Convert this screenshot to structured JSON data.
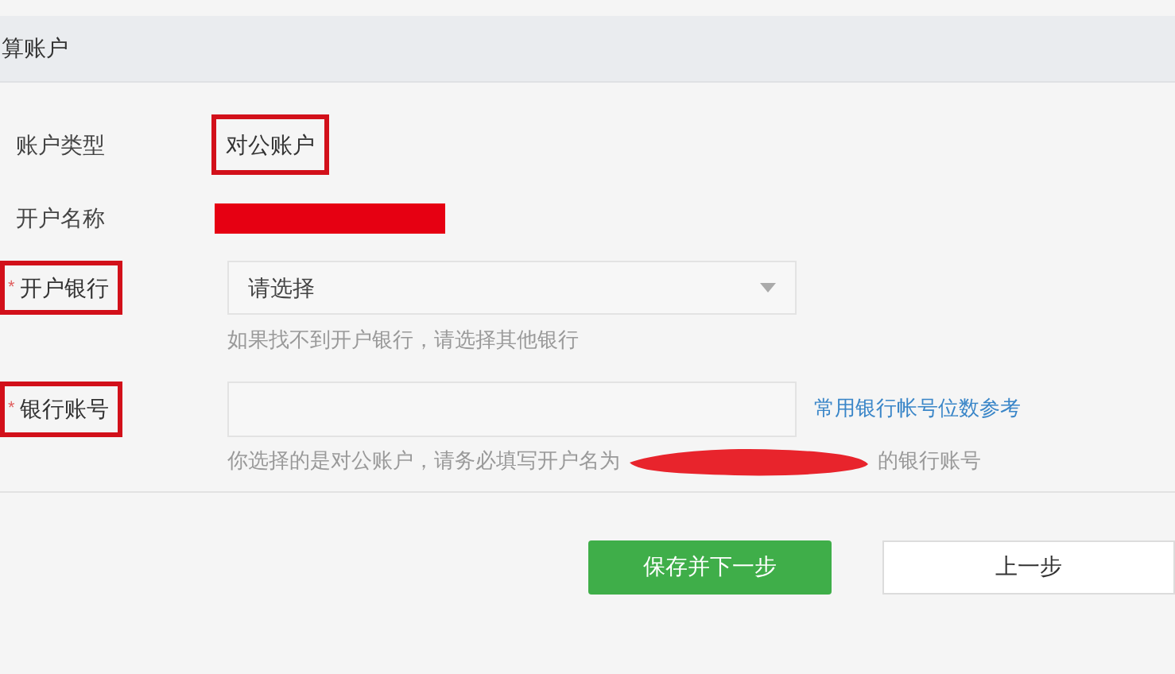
{
  "section_title": "算账户",
  "fields": [
    {
      "kind": "text",
      "label": "账户类型",
      "label_highlighted": false,
      "value_highlighted": true,
      "value": "对公账户"
    },
    {
      "kind": "redacted",
      "label": "开户名称",
      "label_highlighted": false
    },
    {
      "kind": "select",
      "label": "开户银行",
      "required_mark": "*",
      "label_highlighted": true,
      "placeholder": "请选择",
      "hint": "如果找不到开户银行，请选择其他银行"
    },
    {
      "kind": "input",
      "label": "银行账号",
      "required_mark": "*",
      "label_highlighted": true,
      "link": "常用银行帐号位数参考",
      "hint_before": "你选择的是对公账户，请务必填写开户名为",
      "hint_after": "的银行账号"
    }
  ],
  "buttons": [
    {
      "label": "保存并下一步",
      "kind": "primary"
    },
    {
      "label": "上一步",
      "kind": "secondary"
    }
  ]
}
